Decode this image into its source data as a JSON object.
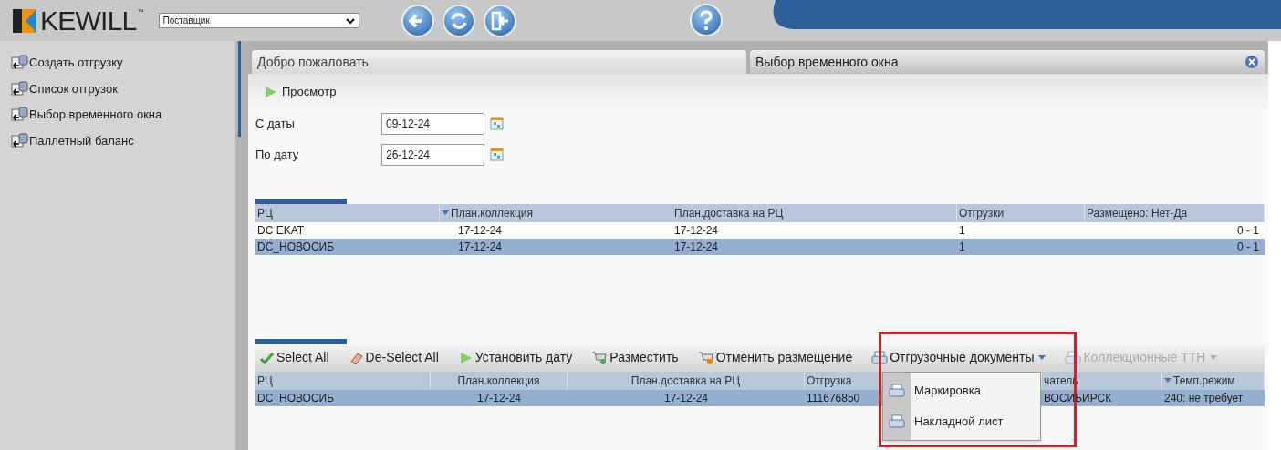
{
  "header": {
    "logo": "KEWILL",
    "trademark": "™",
    "role_select": {
      "value": "Поставщик"
    }
  },
  "sidebar": {
    "items": [
      {
        "label": "Создать отгрузку"
      },
      {
        "label": "Список отгрузок"
      },
      {
        "label": "Выбор временного окна"
      },
      {
        "label": "Паллетный баланс"
      }
    ]
  },
  "tabs": [
    {
      "label": "Добро пожаловать",
      "selected": false
    },
    {
      "label": "Выбор временного окна",
      "selected": true
    }
  ],
  "view_button": "Просмотр",
  "filters": [
    {
      "label": "С даты",
      "value": "09-12-24"
    },
    {
      "label": "По дату",
      "value": "26-12-24"
    }
  ],
  "upper_table": {
    "columns": [
      {
        "label": "РЦ",
        "sorted": false
      },
      {
        "label": "План.коллекция",
        "sorted": true
      },
      {
        "label": "План.доставка на РЦ",
        "sorted": false
      },
      {
        "label": "Отгрузки",
        "sorted": false
      },
      {
        "label": "Размещено: Нет-Да",
        "sorted": false
      }
    ],
    "rows": [
      {
        "cells": [
          "DC EKAT",
          "17-12-24",
          "17-12-24",
          "1",
          "0 - 1"
        ],
        "selected": false
      },
      {
        "cells": [
          "DC_НОВОСИБ",
          "17-12-24",
          "17-12-24",
          "1",
          "0 - 1"
        ],
        "selected": true
      }
    ]
  },
  "toolbar": [
    {
      "kind": "check",
      "label": "Select All",
      "disabled": false,
      "dropdown": false
    },
    {
      "kind": "eraser",
      "label": "De-Select All",
      "disabled": false,
      "dropdown": false
    },
    {
      "kind": "play",
      "label": "Установить дату",
      "disabled": false,
      "dropdown": false
    },
    {
      "kind": "cart-add",
      "label": "Разместить",
      "disabled": false,
      "dropdown": false
    },
    {
      "kind": "cart-remove",
      "label": "Отменить размещение",
      "disabled": false,
      "dropdown": false
    },
    {
      "kind": "printer",
      "label": "Отгрузочные документы",
      "disabled": false,
      "dropdown": true
    },
    {
      "kind": "printer",
      "label": "Коллекционные ТТН",
      "disabled": true,
      "dropdown": true
    }
  ],
  "lower_table": {
    "columns": [
      {
        "label": "РЦ",
        "sorted": false
      },
      {
        "label": "План.коллекция",
        "sorted": false
      },
      {
        "label": "План.доставка на РЦ",
        "sorted": false
      },
      {
        "label": "Отгрузка",
        "sorted": false
      },
      {
        "label": "чатель",
        "sorted": false
      },
      {
        "label": "Темп.режим",
        "sorted": true
      }
    ],
    "rows": [
      {
        "cells": [
          "DC_НОВОСИБ",
          "17-12-24",
          "17-12-24",
          "111676850",
          "ВОСИБИРСК",
          "240: не требует"
        ],
        "selected": true
      }
    ]
  },
  "documents_menu": {
    "items": [
      {
        "label": "Маркировка"
      },
      {
        "label": "Накладной лист"
      }
    ]
  }
}
